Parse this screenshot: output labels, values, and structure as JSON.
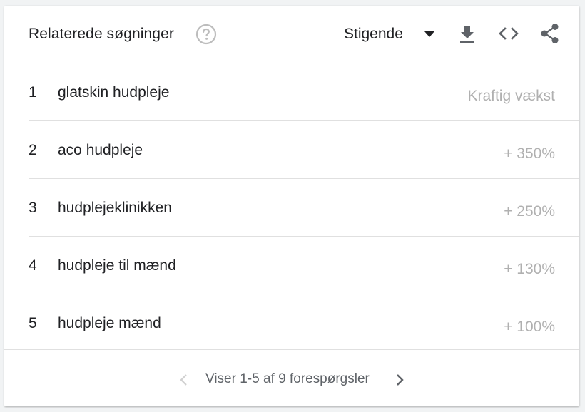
{
  "widget": {
    "title": "Relaterede søgninger",
    "help_icon": "help-circle-icon",
    "sort": {
      "selected": "Stigende"
    },
    "toolbar": {
      "download_icon": "download-icon",
      "embed_icon": "embed-code-icon",
      "share_icon": "share-icon"
    }
  },
  "queries": [
    {
      "rank": "1",
      "query": "glatskin hudpleje",
      "value": "Kraftig vækst"
    },
    {
      "rank": "2",
      "query": "aco hudpleje",
      "value": "+ 350%"
    },
    {
      "rank": "3",
      "query": "hudplejeklinikken",
      "value": "+ 250%"
    },
    {
      "rank": "4",
      "query": "hudpleje til mænd",
      "value": "+ 130%"
    },
    {
      "rank": "5",
      "query": "hudpleje mænd",
      "value": "+ 100%"
    }
  ],
  "pagination": {
    "text": "Viser 1-5 af 9 forespørgsler",
    "prev_icon": "chevron-left-icon",
    "next_icon": "chevron-right-icon"
  },
  "colors": {
    "text": "#202124",
    "muted_value": "#b0b0b0",
    "icon": "#5f6368",
    "icon_light": "#bdbdbd",
    "divider": "#e0e0e0"
  }
}
